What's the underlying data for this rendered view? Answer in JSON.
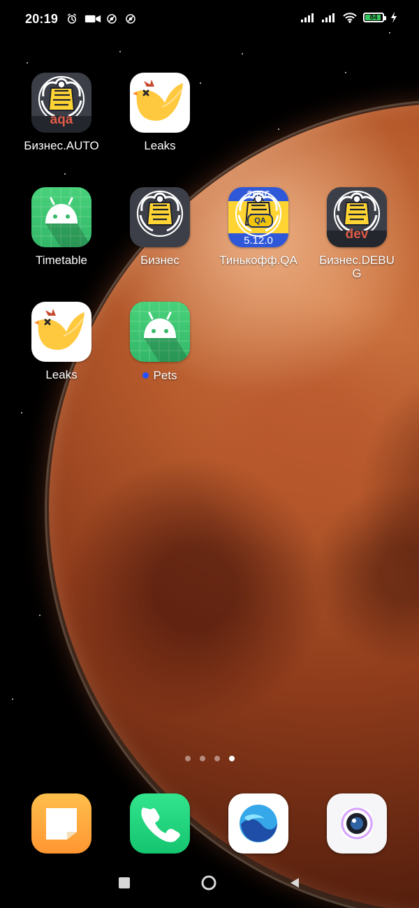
{
  "status_bar": {
    "time": "20:19",
    "battery": "84",
    "icons": [
      "alarm-icon",
      "video-icon",
      "do-not-disturb-icon",
      "do-not-disturb-icon",
      "signal-icon",
      "signal-icon",
      "wifi-icon",
      "battery-icon",
      "charging-icon"
    ]
  },
  "apps": [
    {
      "label": "Бизнес.AUTO",
      "icon": "tinkoff-business-icon",
      "badge": "aqa"
    },
    {
      "label": "Leaks",
      "icon": "leaks-bird-icon"
    },
    {
      "label": "Timetable",
      "icon": "android-icon"
    },
    {
      "label": "Бизнес",
      "icon": "tinkoff-business-icon"
    },
    {
      "label": "Тинькофф.QA",
      "icon": "tinkoff-qa-icon",
      "top": "2626",
      "pill": "QA",
      "bottom": "5.12.0"
    },
    {
      "label_line1": "Бизнес.DEBU",
      "label_line2": "G",
      "icon": "tinkoff-business-icon",
      "badge": "dev"
    },
    {
      "label": "Leaks",
      "icon": "leaks-bird-icon"
    },
    {
      "label": "Pets",
      "icon": "android-icon",
      "status": "notification-dot"
    }
  ],
  "pager": {
    "pages": 4,
    "active": 4
  },
  "dock": [
    {
      "icon": "notes-icon"
    },
    {
      "icon": "phone-icon"
    },
    {
      "icon": "browser-icon"
    },
    {
      "icon": "camera-icon"
    }
  ],
  "navigation": [
    {
      "icon": "recent-apps-icon"
    },
    {
      "icon": "home-icon"
    },
    {
      "icon": "back-icon"
    }
  ],
  "colors": {
    "tinkoff_yellow": "#ffd433",
    "tinkoff_dark": "#3c3f47",
    "android_green": "#48d17a",
    "qa_blue": "#2f58d9",
    "notification_dot": "#2450ff",
    "battery_green": "#36c95e"
  }
}
